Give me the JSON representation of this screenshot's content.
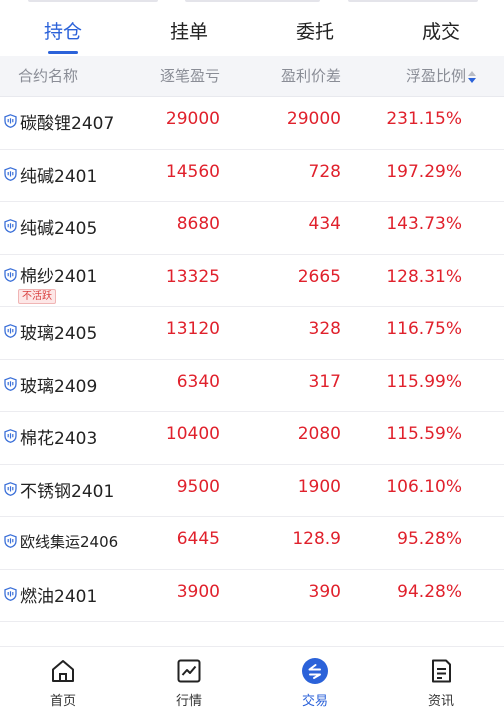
{
  "tabs": [
    "持仓",
    "挂单",
    "委托",
    "成交"
  ],
  "columns": {
    "name": "合约名称",
    "pnl": "逐笔盈亏",
    "diff": "盈利价差",
    "ratio": "浮盈比例"
  },
  "rows": [
    {
      "name": "碳酸锂2407",
      "pnl": "29000",
      "diff": "29000",
      "ratio": "231.15%"
    },
    {
      "name": "纯碱2401",
      "pnl": "14560",
      "diff": "728",
      "ratio": "197.29%"
    },
    {
      "name": "纯碱2405",
      "pnl": "8680",
      "diff": "434",
      "ratio": "143.73%"
    },
    {
      "name": "棉纱2401",
      "pnl": "13325",
      "diff": "2665",
      "ratio": "128.31%",
      "badge": "不活跃"
    },
    {
      "name": "玻璃2405",
      "pnl": "13120",
      "diff": "328",
      "ratio": "116.75%"
    },
    {
      "name": "玻璃2409",
      "pnl": "6340",
      "diff": "317",
      "ratio": "115.99%"
    },
    {
      "name": "棉花2403",
      "pnl": "10400",
      "diff": "2080",
      "ratio": "115.59%"
    },
    {
      "name": "不锈钢2401",
      "pnl": "9500",
      "diff": "1900",
      "ratio": "106.10%"
    },
    {
      "name": "欧线集运2406",
      "pnl": "6445",
      "diff": "128.9",
      "ratio": "95.28%"
    },
    {
      "name": "燃油2401",
      "pnl": "3900",
      "diff": "390",
      "ratio": "94.28%"
    }
  ],
  "nav": [
    {
      "label": "首页",
      "icon": "home-icon"
    },
    {
      "label": "行情",
      "icon": "chart-icon"
    },
    {
      "label": "交易",
      "icon": "trade-icon"
    },
    {
      "label": "资讯",
      "icon": "news-icon"
    }
  ],
  "colors": {
    "accent": "#2b62d9",
    "profit": "#e0212c"
  }
}
